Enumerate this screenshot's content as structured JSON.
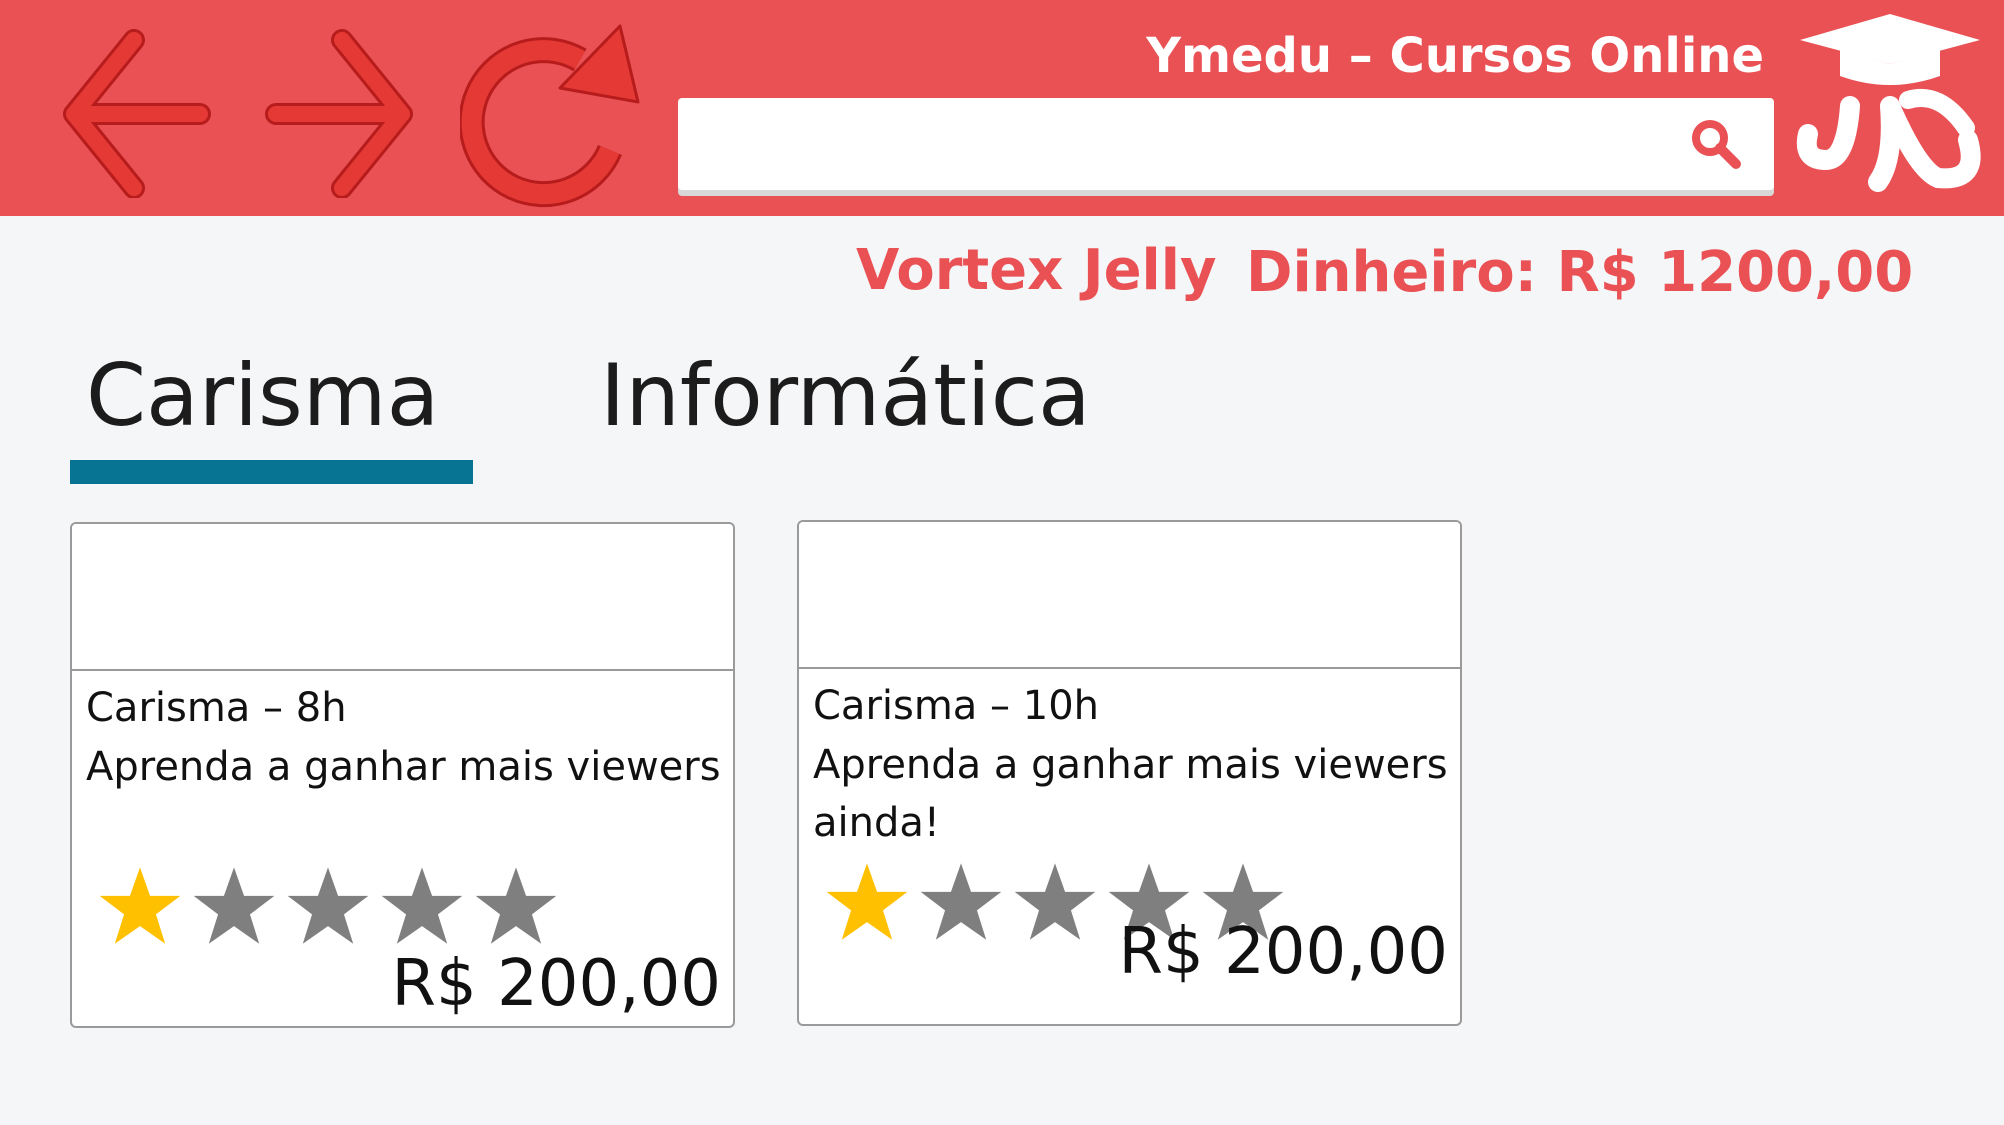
{
  "header": {
    "site_title": "Ymedu – Cursos Online",
    "search": {
      "value": "",
      "placeholder": ""
    },
    "colors": {
      "bar": "#ea5154",
      "icon": "#e53935"
    },
    "icons": [
      "back-arrow-icon",
      "forward-arrow-icon",
      "reload-icon",
      "search-icon",
      "graduation-cap-logo"
    ]
  },
  "user": {
    "name": "Vortex Jelly",
    "money_label": "Dinheiro:",
    "money_value": "R$ 1200,00"
  },
  "tabs": [
    {
      "label": "Carisma",
      "active": true
    },
    {
      "label": "Informática",
      "active": false
    }
  ],
  "courses": [
    {
      "title": "Carisma – 8h",
      "description": "Aprenda a ganhar mais viewers",
      "rating": 1,
      "rating_max": 5,
      "price": "R$ 200,00"
    },
    {
      "title": "Carisma – 10h",
      "description": "Aprenda a ganhar mais viewers ainda!",
      "rating": 1,
      "rating_max": 5,
      "price": "R$ 200,00"
    }
  ],
  "colors": {
    "accent_tab": "#087494",
    "star_filled": "#ffc000",
    "star_empty": "#7f7f7f"
  }
}
